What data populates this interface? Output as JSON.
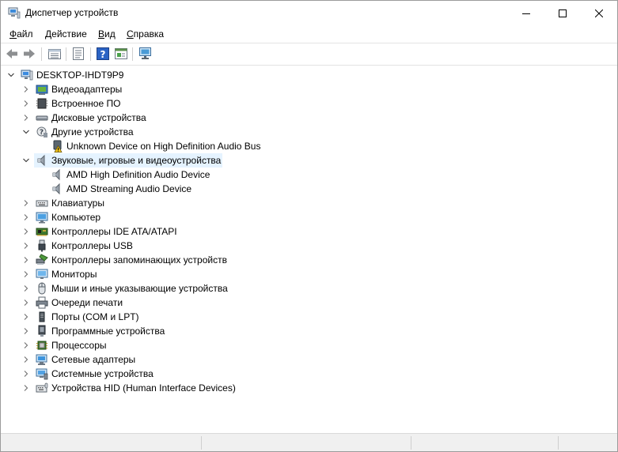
{
  "window": {
    "title": "Диспетчер устройств"
  },
  "menu": {
    "file": {
      "accel": "Ф",
      "rest": "айл"
    },
    "action": {
      "accel": "Д",
      "rest": "ействие"
    },
    "view": {
      "accel": "В",
      "rest": "ид"
    },
    "help": {
      "accel": "С",
      "rest": "правка"
    }
  },
  "toolbar": {
    "icons": [
      "back-icon",
      "forward-icon",
      "properties-list-icon",
      "device-view-icon",
      "help-icon",
      "resources-view-icon",
      "scan-hardware-icon"
    ]
  },
  "tree": {
    "root": "DESKTOP-IHDT9P9",
    "selected": "Звуковые, игровые и видеоустройства",
    "items": [
      {
        "label": "Видеоадаптеры",
        "expanded": false,
        "icon": "display-adapter-icon"
      },
      {
        "label": "Встроенное ПО",
        "expanded": false,
        "icon": "firmware-icon"
      },
      {
        "label": "Дисковые устройства",
        "expanded": false,
        "icon": "disk-drive-icon"
      },
      {
        "label": "Другие устройства",
        "expanded": true,
        "icon": "unknown-device-icon",
        "children": [
          {
            "label": "Unknown Device on High Definition Audio Bus",
            "icon": "warning-device-icon"
          }
        ]
      },
      {
        "label": "Звуковые, игровые и видеоустройства",
        "expanded": true,
        "icon": "speaker-icon",
        "children": [
          {
            "label": "AMD High Definition Audio Device",
            "icon": "speaker-icon"
          },
          {
            "label": "AMD Streaming Audio Device",
            "icon": "speaker-icon"
          }
        ]
      },
      {
        "label": "Клавиатуры",
        "expanded": false,
        "icon": "keyboard-icon"
      },
      {
        "label": "Компьютер",
        "expanded": false,
        "icon": "computer-icon"
      },
      {
        "label": "Контроллеры IDE ATA/ATAPI",
        "expanded": false,
        "icon": "ide-controller-icon"
      },
      {
        "label": "Контроллеры USB",
        "expanded": false,
        "icon": "usb-icon"
      },
      {
        "label": "Контроллеры запоминающих устройств",
        "expanded": false,
        "icon": "storage-controller-icon"
      },
      {
        "label": "Мониторы",
        "expanded": false,
        "icon": "monitor-icon"
      },
      {
        "label": "Мыши и иные указывающие устройства",
        "expanded": false,
        "icon": "mouse-icon"
      },
      {
        "label": "Очереди печати",
        "expanded": false,
        "icon": "printer-icon"
      },
      {
        "label": "Порты (COM и LPT)",
        "expanded": false,
        "icon": "port-icon"
      },
      {
        "label": "Программные устройства",
        "expanded": false,
        "icon": "software-device-icon"
      },
      {
        "label": "Процессоры",
        "expanded": false,
        "icon": "processor-icon"
      },
      {
        "label": "Сетевые адаптеры",
        "expanded": false,
        "icon": "network-adapter-icon"
      },
      {
        "label": "Системные устройства",
        "expanded": false,
        "icon": "system-device-icon"
      },
      {
        "label": "Устройства HID (Human Interface Devices)",
        "expanded": false,
        "icon": "hid-icon"
      }
    ]
  },
  "colors": {
    "selection": "#e5f3ff",
    "accent": "#1f73c6"
  }
}
